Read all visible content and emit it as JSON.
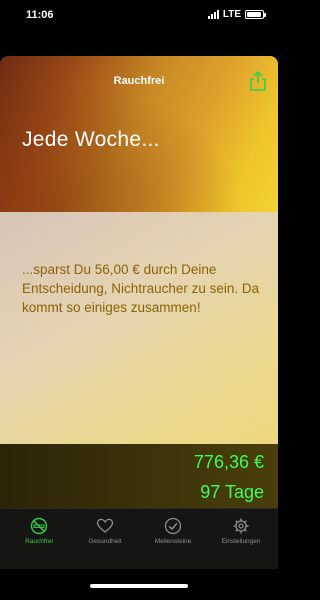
{
  "status_bar": {
    "time": "11:06",
    "network": "LTE"
  },
  "header": {
    "title": "Rauchfrei"
  },
  "hero": {
    "title": "Jede Woche..."
  },
  "card": {
    "text": "...sparst Du 56,00 € durch Deine Entscheidung, Nichtraucher zu sein. Da kommt so einiges zusammen!"
  },
  "actions": [
    {
      "icon": "plus-icon"
    },
    {
      "icon": "pencil-icon"
    },
    {
      "icon": "currency-exchange-icon"
    },
    {
      "icon": "skull-crossbones-icon"
    }
  ],
  "stats": {
    "money": "776,36 €",
    "days": "97 Tage"
  },
  "tabs": [
    {
      "label": "Rauchfrei",
      "icon": "no-smoking-icon",
      "active": true
    },
    {
      "label": "Gesundheit",
      "icon": "heart-icon",
      "active": false
    },
    {
      "label": "Meilensteine",
      "icon": "checkmark-circle-icon",
      "active": false
    },
    {
      "label": "Einstellungen",
      "icon": "gear-icon",
      "active": false
    }
  ],
  "colors": {
    "accent_green": "#2fd34a",
    "stats_green": "#3cff52",
    "card_text": "#8a6405"
  }
}
